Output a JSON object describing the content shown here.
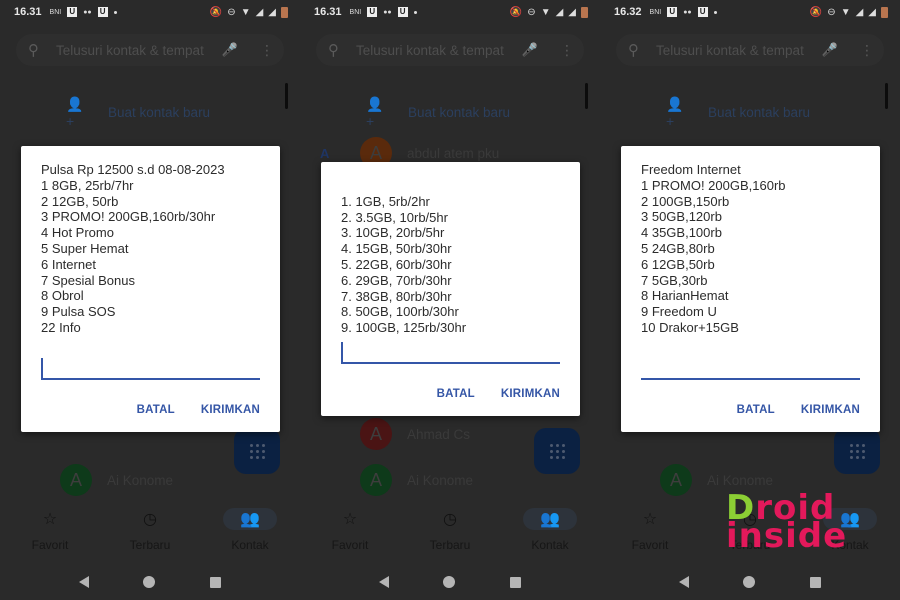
{
  "colors": {
    "accent": "#3556a6",
    "dialog_bg": "#ffffff",
    "screen_bg": "#2a2a2a",
    "logo_green": "#8ccf34",
    "logo_pink": "#e3195b"
  },
  "common": {
    "search_placeholder": "Telusuri kontak & tempat",
    "new_contact_label": "Buat kontak baru",
    "status_icons": [
      "bni-icon",
      "u-app-icon",
      "chat-icon",
      "u-app-icon",
      "dot-icon"
    ],
    "status_right_icons": [
      "mute-icon",
      "dnd-icon",
      "wifi-icon",
      "signal-icon",
      "signal-icon",
      "battery-icon"
    ],
    "bottom_nav": [
      {
        "label": "Favorit",
        "icon": "star-icon",
        "active": false
      },
      {
        "label": "Terbaru",
        "icon": "clock-icon",
        "active": false
      },
      {
        "label": "Kontak",
        "icon": "people-icon",
        "active": true
      }
    ],
    "cancel_label": "BATAL",
    "send_label": "KIRIMKAN",
    "bni_text": "BNI",
    "u_text": "U"
  },
  "screens": [
    {
      "time": "16.31",
      "contacts": [
        {
          "initial": "A",
          "name": "Ai Konome",
          "color": "#0e3a1a"
        }
      ],
      "dialog_lines": [
        "Pulsa Rp 12500 s.d 08-08-2023",
        "1 8GB, 25rb/7hr",
        "2 12GB, 50rb",
        "3 PROMO! 200GB,160rb/30hr",
        "4 Hot Promo",
        "5 Super Hemat",
        "6 Internet",
        "7 Spesial Bonus",
        "8 Obrol",
        "9 Pulsa SOS",
        "22 Info"
      ],
      "input_value": ""
    },
    {
      "time": "16.31",
      "section_letter": "A",
      "contacts": [
        {
          "initial": "A",
          "name": "abdul atem pku",
          "color": "#5a2a0c"
        },
        {
          "initial": "A",
          "name": "Ahmad Cs",
          "color": "#4a1414"
        },
        {
          "initial": "A",
          "name": "Ai Konome",
          "color": "#0e3a1a"
        }
      ],
      "dialog_lines": [
        "",
        "1. 1GB, 5rb/2hr",
        "2. 3.5GB, 10rb/5hr",
        "3. 10GB, 20rb/5hr",
        "4. 15GB, 50rb/30hr",
        "5. 22GB, 60rb/30hr",
        "6. 29GB, 70rb/30hr",
        "7. 38GB, 80rb/30hr",
        "8. 50GB, 100rb/30hr",
        "9. 100GB, 125rb/30hr"
      ],
      "input_value": ""
    },
    {
      "time": "16.32",
      "contacts": [
        {
          "initial": "A",
          "name": "Ai Konome",
          "color": "#0e3a1a"
        }
      ],
      "dialog_lines": [
        "Freedom Internet",
        "1 PROMO! 200GB,160rb",
        "2 100GB,150rb",
        "3 50GB,120rb",
        "4 35GB,100rb",
        "5 24GB,80rb",
        "6 12GB,50rb",
        "7 5GB,30rb",
        "8 HarianHemat",
        "9 Freedom U",
        "10 Drakor+15GB"
      ],
      "input_value": ""
    }
  ],
  "watermark": {
    "line1_first": "D",
    "line1_rest": "roid",
    "line2": "inside"
  }
}
